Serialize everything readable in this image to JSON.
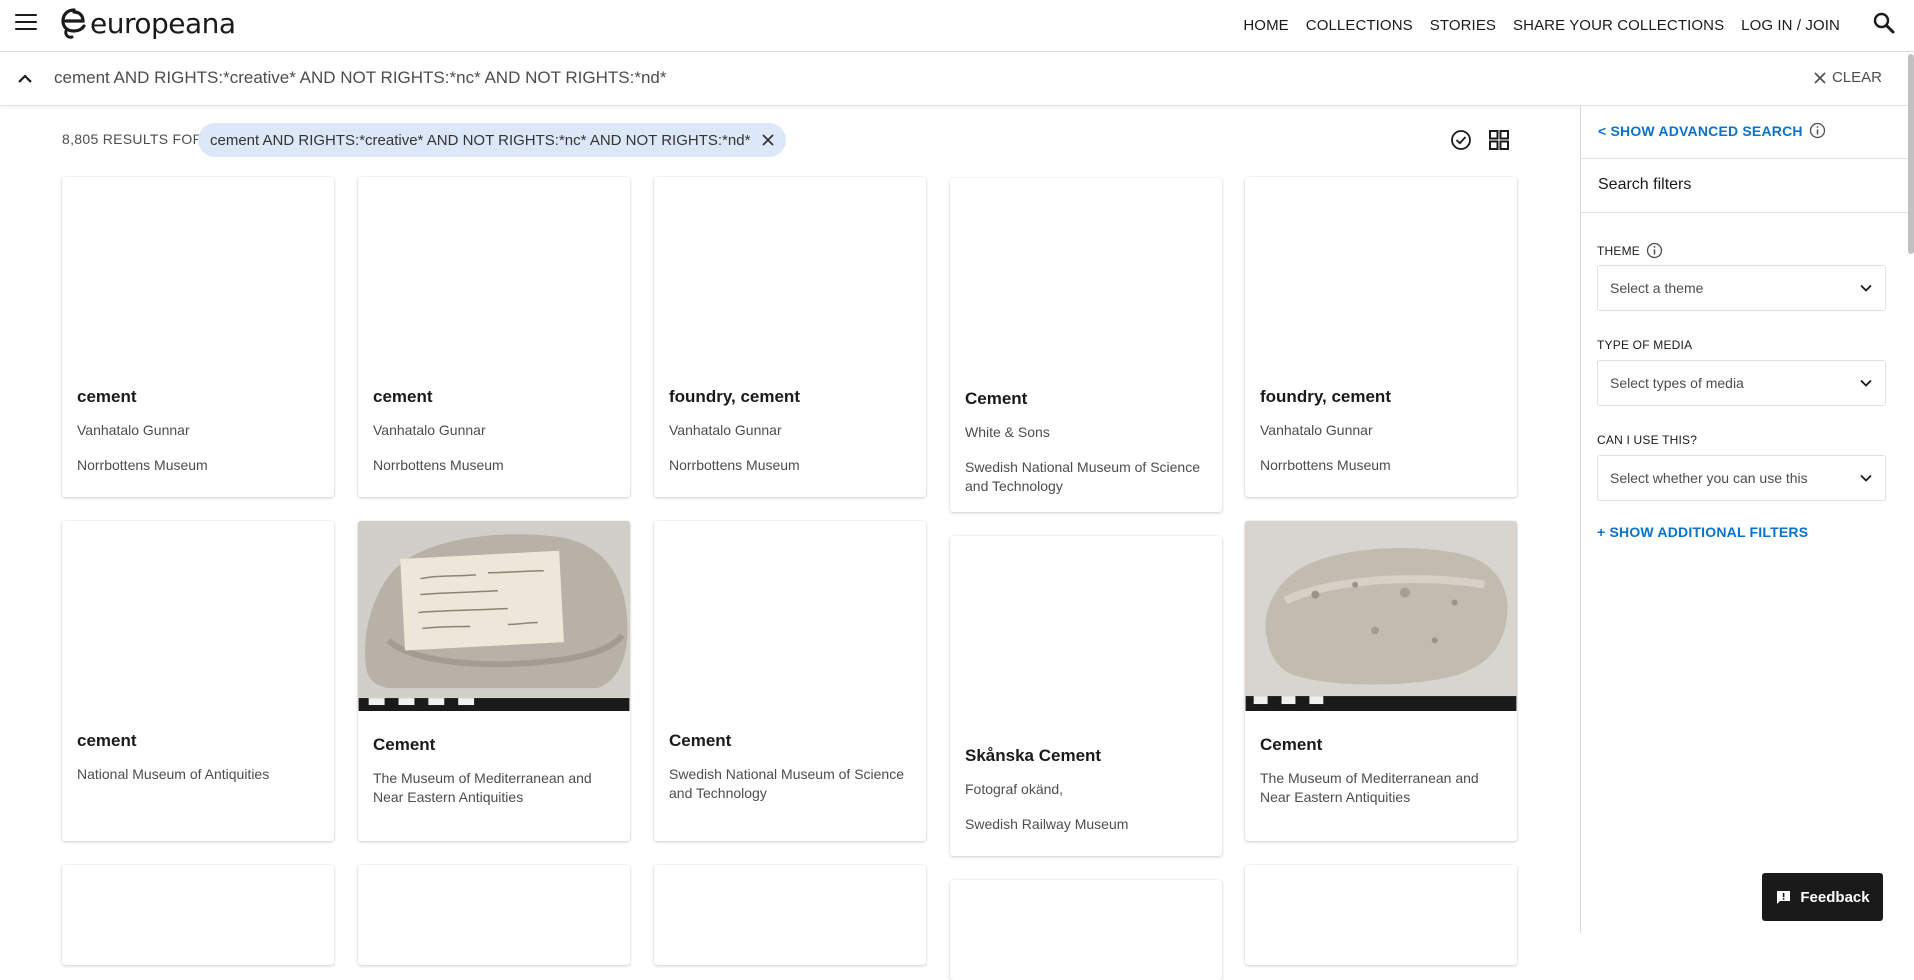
{
  "header": {
    "logo_text": "europeana",
    "nav": [
      "HOME",
      "COLLECTIONS",
      "STORIES",
      "SHARE YOUR COLLECTIONS",
      "LOG IN / JOIN"
    ]
  },
  "search": {
    "query": "cement AND RIGHTS:*creative* AND NOT RIGHTS:*nc* AND NOT RIGHTS:*nd*",
    "clear_label": "CLEAR"
  },
  "results": {
    "count_label": "8,805 RESULTS FOR",
    "pill_text": "cement AND RIGHTS:*creative* AND NOT RIGHTS:*nc* AND NOT RIGHTS:*nd*"
  },
  "cards": [
    {
      "title": "cement",
      "lines": [
        "Vanhatalo Gunnar",
        "Norrbottens Museum"
      ],
      "image": "none"
    },
    {
      "title": "cement",
      "lines": [
        "Vanhatalo Gunnar",
        "Norrbottens Museum"
      ],
      "image": "none"
    },
    {
      "title": "foundry, cement",
      "lines": [
        "Vanhatalo Gunnar",
        "Norrbottens Museum"
      ],
      "image": "none"
    },
    {
      "title": "Cement",
      "lines": [
        "White & Sons",
        "Swedish National Museum of Science and Technology"
      ],
      "image": "none"
    },
    {
      "title": "foundry, cement",
      "lines": [
        "Vanhatalo Gunnar",
        "Norrbottens Museum"
      ],
      "image": "none"
    },
    {
      "title": "cement",
      "lines": [
        "National Museum of Antiquities"
      ],
      "image": "none"
    },
    {
      "title": "Cement",
      "lines": [
        "The Museum of Mediterranean and Near Eastern Antiquities"
      ],
      "image": "stone-with-note"
    },
    {
      "title": "Cement",
      "lines": [
        "Swedish National Museum of Science and Technology"
      ],
      "image": "none"
    },
    {
      "title": "Skånska Cement",
      "lines": [
        "Fotograf okänd,",
        "Swedish Railway Museum"
      ],
      "image": "none"
    },
    {
      "title": "Cement",
      "lines": [
        "The Museum of Mediterranean and Near Eastern Antiquities"
      ],
      "image": "stone"
    }
  ],
  "sidebar": {
    "advanced_search": "< SHOW ADVANCED SEARCH",
    "heading": "Search filters",
    "filters": [
      {
        "label": "THEME",
        "placeholder": "Select a theme",
        "info": true
      },
      {
        "label": "TYPE OF MEDIA",
        "placeholder": "Select types of media",
        "info": false
      },
      {
        "label": "CAN I USE THIS?",
        "placeholder": "Select whether you can use this",
        "info": false
      }
    ],
    "more_filters": "+ SHOW ADDITIONAL FILTERS"
  },
  "feedback": {
    "label": "Feedback"
  },
  "colors": {
    "accent": "#0a72cc",
    "pill_bg": "#dce8f7",
    "feedback_bg": "#1a1a1a"
  }
}
